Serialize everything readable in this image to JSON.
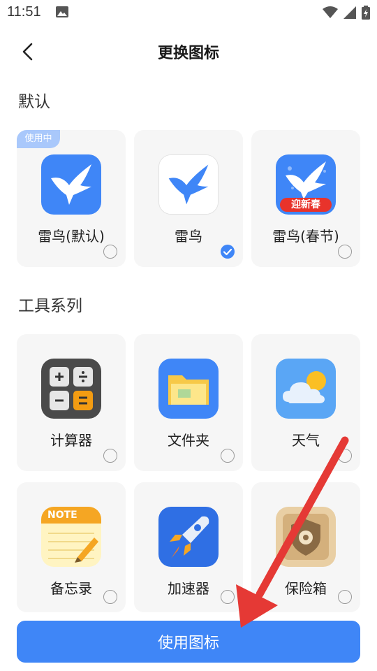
{
  "status": {
    "time": "11:51"
  },
  "header": {
    "title": "更换图标"
  },
  "sections": {
    "default": {
      "title": "默认",
      "items": [
        {
          "label": "雷鸟(默认)",
          "badge": "使用中",
          "icon": "bird-blue-icon",
          "checked": false
        },
        {
          "label": "雷鸟",
          "icon": "bird-white-icon",
          "checked": true
        },
        {
          "label": "雷鸟(春节)",
          "icon": "bird-spring-icon",
          "banner": "迎新春",
          "checked": false
        }
      ]
    },
    "tools": {
      "title": "工具系列",
      "items": [
        {
          "label": "计算器",
          "icon": "calculator-icon",
          "checked": false
        },
        {
          "label": "文件夹",
          "icon": "folder-icon",
          "checked": false
        },
        {
          "label": "天气",
          "icon": "weather-icon",
          "checked": false
        },
        {
          "label": "备忘录",
          "icon": "note-icon",
          "note_text": "NOTE",
          "checked": false
        },
        {
          "label": "加速器",
          "icon": "rocket-icon",
          "checked": false
        },
        {
          "label": "保险箱",
          "icon": "safe-icon",
          "checked": false
        }
      ]
    }
  },
  "footer": {
    "button_label": "使用图标"
  },
  "colors": {
    "accent": "#3f86f7",
    "card_bg": "#f6f6f6",
    "annotation_arrow": "#e53935"
  }
}
